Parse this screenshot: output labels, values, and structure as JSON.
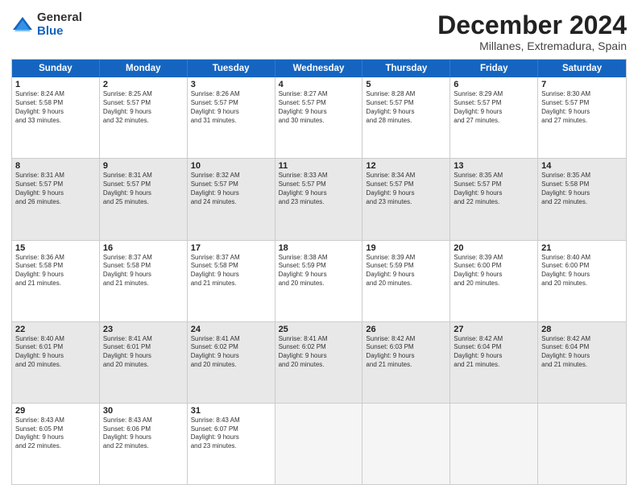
{
  "logo": {
    "general": "General",
    "blue": "Blue"
  },
  "title": "December 2024",
  "location": "Millanes, Extremadura, Spain",
  "header_days": [
    "Sunday",
    "Monday",
    "Tuesday",
    "Wednesday",
    "Thursday",
    "Friday",
    "Saturday"
  ],
  "weeks": [
    [
      {
        "day": "1",
        "lines": [
          "Sunrise: 8:24 AM",
          "Sunset: 5:58 PM",
          "Daylight: 9 hours",
          "and 33 minutes."
        ],
        "empty": false,
        "shaded": false
      },
      {
        "day": "2",
        "lines": [
          "Sunrise: 8:25 AM",
          "Sunset: 5:57 PM",
          "Daylight: 9 hours",
          "and 32 minutes."
        ],
        "empty": false,
        "shaded": false
      },
      {
        "day": "3",
        "lines": [
          "Sunrise: 8:26 AM",
          "Sunset: 5:57 PM",
          "Daylight: 9 hours",
          "and 31 minutes."
        ],
        "empty": false,
        "shaded": false
      },
      {
        "day": "4",
        "lines": [
          "Sunrise: 8:27 AM",
          "Sunset: 5:57 PM",
          "Daylight: 9 hours",
          "and 30 minutes."
        ],
        "empty": false,
        "shaded": false
      },
      {
        "day": "5",
        "lines": [
          "Sunrise: 8:28 AM",
          "Sunset: 5:57 PM",
          "Daylight: 9 hours",
          "and 28 minutes."
        ],
        "empty": false,
        "shaded": false
      },
      {
        "day": "6",
        "lines": [
          "Sunrise: 8:29 AM",
          "Sunset: 5:57 PM",
          "Daylight: 9 hours",
          "and 27 minutes."
        ],
        "empty": false,
        "shaded": false
      },
      {
        "day": "7",
        "lines": [
          "Sunrise: 8:30 AM",
          "Sunset: 5:57 PM",
          "Daylight: 9 hours",
          "and 27 minutes."
        ],
        "empty": false,
        "shaded": false
      }
    ],
    [
      {
        "day": "8",
        "lines": [
          "Sunrise: 8:31 AM",
          "Sunset: 5:57 PM",
          "Daylight: 9 hours",
          "and 26 minutes."
        ],
        "empty": false,
        "shaded": true
      },
      {
        "day": "9",
        "lines": [
          "Sunrise: 8:31 AM",
          "Sunset: 5:57 PM",
          "Daylight: 9 hours",
          "and 25 minutes."
        ],
        "empty": false,
        "shaded": true
      },
      {
        "day": "10",
        "lines": [
          "Sunrise: 8:32 AM",
          "Sunset: 5:57 PM",
          "Daylight: 9 hours",
          "and 24 minutes."
        ],
        "empty": false,
        "shaded": true
      },
      {
        "day": "11",
        "lines": [
          "Sunrise: 8:33 AM",
          "Sunset: 5:57 PM",
          "Daylight: 9 hours",
          "and 23 minutes."
        ],
        "empty": false,
        "shaded": true
      },
      {
        "day": "12",
        "lines": [
          "Sunrise: 8:34 AM",
          "Sunset: 5:57 PM",
          "Daylight: 9 hours",
          "and 23 minutes."
        ],
        "empty": false,
        "shaded": true
      },
      {
        "day": "13",
        "lines": [
          "Sunrise: 8:35 AM",
          "Sunset: 5:57 PM",
          "Daylight: 9 hours",
          "and 22 minutes."
        ],
        "empty": false,
        "shaded": true
      },
      {
        "day": "14",
        "lines": [
          "Sunrise: 8:35 AM",
          "Sunset: 5:58 PM",
          "Daylight: 9 hours",
          "and 22 minutes."
        ],
        "empty": false,
        "shaded": true
      }
    ],
    [
      {
        "day": "15",
        "lines": [
          "Sunrise: 8:36 AM",
          "Sunset: 5:58 PM",
          "Daylight: 9 hours",
          "and 21 minutes."
        ],
        "empty": false,
        "shaded": false
      },
      {
        "day": "16",
        "lines": [
          "Sunrise: 8:37 AM",
          "Sunset: 5:58 PM",
          "Daylight: 9 hours",
          "and 21 minutes."
        ],
        "empty": false,
        "shaded": false
      },
      {
        "day": "17",
        "lines": [
          "Sunrise: 8:37 AM",
          "Sunset: 5:58 PM",
          "Daylight: 9 hours",
          "and 21 minutes."
        ],
        "empty": false,
        "shaded": false
      },
      {
        "day": "18",
        "lines": [
          "Sunrise: 8:38 AM",
          "Sunset: 5:59 PM",
          "Daylight: 9 hours",
          "and 20 minutes."
        ],
        "empty": false,
        "shaded": false
      },
      {
        "day": "19",
        "lines": [
          "Sunrise: 8:39 AM",
          "Sunset: 5:59 PM",
          "Daylight: 9 hours",
          "and 20 minutes."
        ],
        "empty": false,
        "shaded": false
      },
      {
        "day": "20",
        "lines": [
          "Sunrise: 8:39 AM",
          "Sunset: 6:00 PM",
          "Daylight: 9 hours",
          "and 20 minutes."
        ],
        "empty": false,
        "shaded": false
      },
      {
        "day": "21",
        "lines": [
          "Sunrise: 8:40 AM",
          "Sunset: 6:00 PM",
          "Daylight: 9 hours",
          "and 20 minutes."
        ],
        "empty": false,
        "shaded": false
      }
    ],
    [
      {
        "day": "22",
        "lines": [
          "Sunrise: 8:40 AM",
          "Sunset: 6:01 PM",
          "Daylight: 9 hours",
          "and 20 minutes."
        ],
        "empty": false,
        "shaded": true
      },
      {
        "day": "23",
        "lines": [
          "Sunrise: 8:41 AM",
          "Sunset: 6:01 PM",
          "Daylight: 9 hours",
          "and 20 minutes."
        ],
        "empty": false,
        "shaded": true
      },
      {
        "day": "24",
        "lines": [
          "Sunrise: 8:41 AM",
          "Sunset: 6:02 PM",
          "Daylight: 9 hours",
          "and 20 minutes."
        ],
        "empty": false,
        "shaded": true
      },
      {
        "day": "25",
        "lines": [
          "Sunrise: 8:41 AM",
          "Sunset: 6:02 PM",
          "Daylight: 9 hours",
          "and 20 minutes."
        ],
        "empty": false,
        "shaded": true
      },
      {
        "day": "26",
        "lines": [
          "Sunrise: 8:42 AM",
          "Sunset: 6:03 PM",
          "Daylight: 9 hours",
          "and 21 minutes."
        ],
        "empty": false,
        "shaded": true
      },
      {
        "day": "27",
        "lines": [
          "Sunrise: 8:42 AM",
          "Sunset: 6:04 PM",
          "Daylight: 9 hours",
          "and 21 minutes."
        ],
        "empty": false,
        "shaded": true
      },
      {
        "day": "28",
        "lines": [
          "Sunrise: 8:42 AM",
          "Sunset: 6:04 PM",
          "Daylight: 9 hours",
          "and 21 minutes."
        ],
        "empty": false,
        "shaded": true
      }
    ],
    [
      {
        "day": "29",
        "lines": [
          "Sunrise: 8:43 AM",
          "Sunset: 6:05 PM",
          "Daylight: 9 hours",
          "and 22 minutes."
        ],
        "empty": false,
        "shaded": false
      },
      {
        "day": "30",
        "lines": [
          "Sunrise: 8:43 AM",
          "Sunset: 6:06 PM",
          "Daylight: 9 hours",
          "and 22 minutes."
        ],
        "empty": false,
        "shaded": false
      },
      {
        "day": "31",
        "lines": [
          "Sunrise: 8:43 AM",
          "Sunset: 6:07 PM",
          "Daylight: 9 hours",
          "and 23 minutes."
        ],
        "empty": false,
        "shaded": false
      },
      {
        "day": "",
        "lines": [],
        "empty": true,
        "shaded": false
      },
      {
        "day": "",
        "lines": [],
        "empty": true,
        "shaded": false
      },
      {
        "day": "",
        "lines": [],
        "empty": true,
        "shaded": false
      },
      {
        "day": "",
        "lines": [],
        "empty": true,
        "shaded": false
      }
    ]
  ]
}
